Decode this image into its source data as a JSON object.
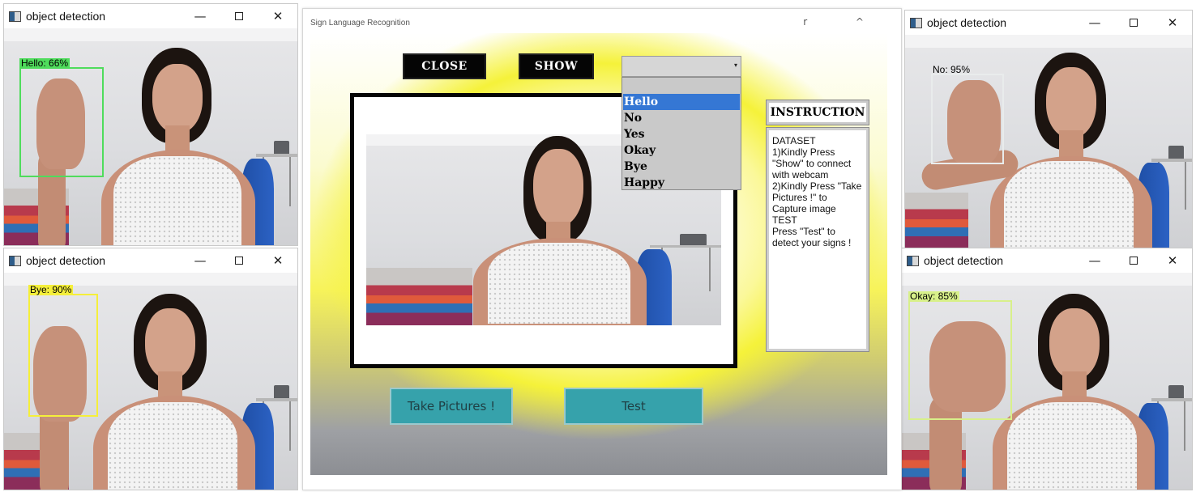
{
  "windows": {
    "common": {
      "title": "object detection",
      "minimize": "—",
      "close": "✕"
    },
    "hello": {
      "label": "Hello: 66%",
      "box_color": "#4fdc5c"
    },
    "bye": {
      "label": "Bye: 90%",
      "box_color": "#f5ef3a"
    },
    "no": {
      "label": "No: 95%",
      "box_color": "#e9ecec"
    },
    "okay": {
      "label": "Okay: 85%",
      "box_color": "#d8f08a"
    }
  },
  "app": {
    "title": "Sign Language Recognition",
    "title_controls": "r ^",
    "close_button": "CLOSE",
    "show_button": "SHOW",
    "combo_arrow": "▾",
    "dropdown_options": [
      "Hello",
      "No",
      "Yes",
      "Okay",
      "Bye",
      "Happy"
    ],
    "selected_option": "Hello",
    "instruction_title": "INSTRUCTION",
    "instruction_lines": [
      "DATASET",
      "1)Kindly Press",
      "\"Show\" to connect",
      "with webcam",
      "2)Kindly Press \"Take",
      "Pictures !\" to",
      "Capture image",
      "",
      "TEST",
      "Press \"Test\" to",
      "detect your signs !"
    ],
    "take_pictures_button": "Take Pictures !",
    "test_button": "Test"
  },
  "colors": {
    "accent_yellow": "#f5f23a",
    "button_teal": "#36a2ab",
    "selection_blue": "#3577d4"
  }
}
